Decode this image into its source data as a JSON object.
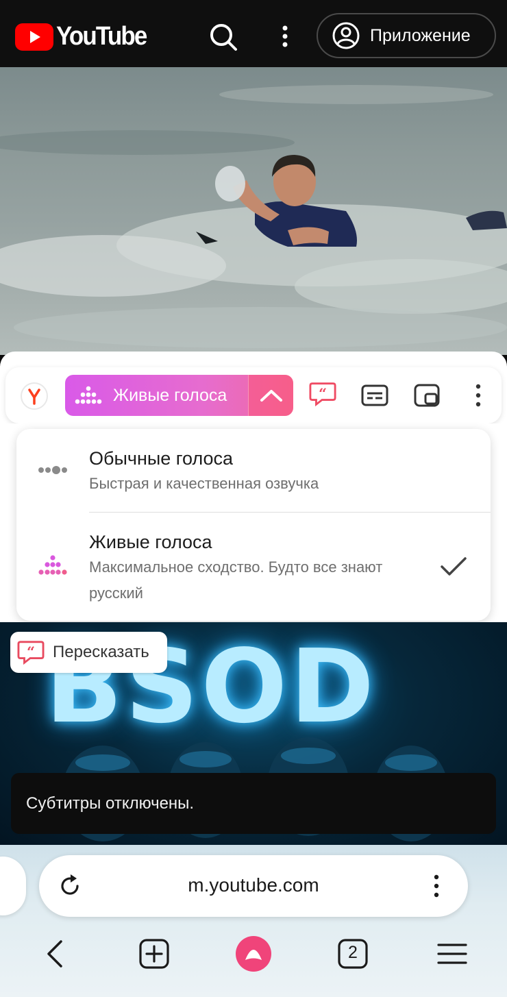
{
  "youtube_header": {
    "logo_text": "YouTube",
    "app_button_label": "Приложение"
  },
  "translation_toolbar": {
    "voice_mode_label": "Живые голоса",
    "accent_gradient": [
      "#d95ae8",
      "#f06aa0"
    ]
  },
  "voice_menu": {
    "items": [
      {
        "title": "Обычные голоса",
        "subtitle": "Быстрая и качественная озвучка",
        "selected": false
      },
      {
        "title": "Живые голоса",
        "subtitle": "Максимальное сходство. Будто все знают русский",
        "selected": true
      }
    ]
  },
  "second_video": {
    "thumbnail_text": "BSOD",
    "retell_button_label": "Пересказать",
    "toast_text": "Субтитры отключены."
  },
  "browser": {
    "url": "m.youtube.com",
    "tab_count": "2"
  },
  "colors": {
    "youtube_red": "#ff0000",
    "alice_pink": "#f0447a",
    "retell_red": "#e84a5f"
  }
}
